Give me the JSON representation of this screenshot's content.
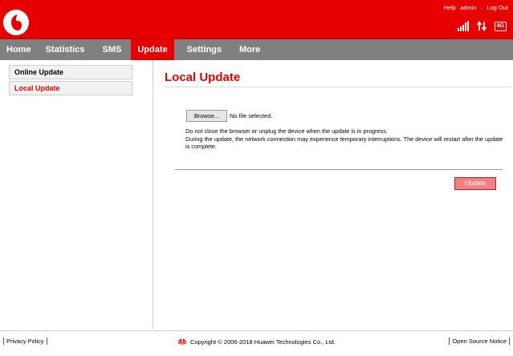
{
  "header": {
    "links": {
      "help": "Help",
      "user": "admin",
      "separator": "·",
      "logout": "Log Out"
    },
    "network_badge": "4G",
    "brand_color": "#e60000"
  },
  "nav": {
    "items": [
      {
        "label": "Home"
      },
      {
        "label": "Statistics"
      },
      {
        "label": "SMS"
      },
      {
        "label": "Update",
        "active": true
      },
      {
        "label": "Settings"
      },
      {
        "label": "More"
      }
    ]
  },
  "sidebar": {
    "items": [
      {
        "label": "Online Update"
      },
      {
        "label": "Local Update",
        "active": true
      }
    ]
  },
  "main": {
    "title": "Local Update",
    "browse_label": "Browse...",
    "file_status": "No file selected.",
    "info_line1": "Do not close the browser or unplug the device when the update is in progress.",
    "info_line2": "During the update, the network connection may experience temporary interruptions. The device will restart after the update is complete.",
    "update_label": "Update"
  },
  "footer": {
    "privacy": "Privacy Policy",
    "copyright": "Copyright © 2006-2018 Huawei Technologies Co., Ltd.",
    "opensource": "Open Source Notice"
  }
}
